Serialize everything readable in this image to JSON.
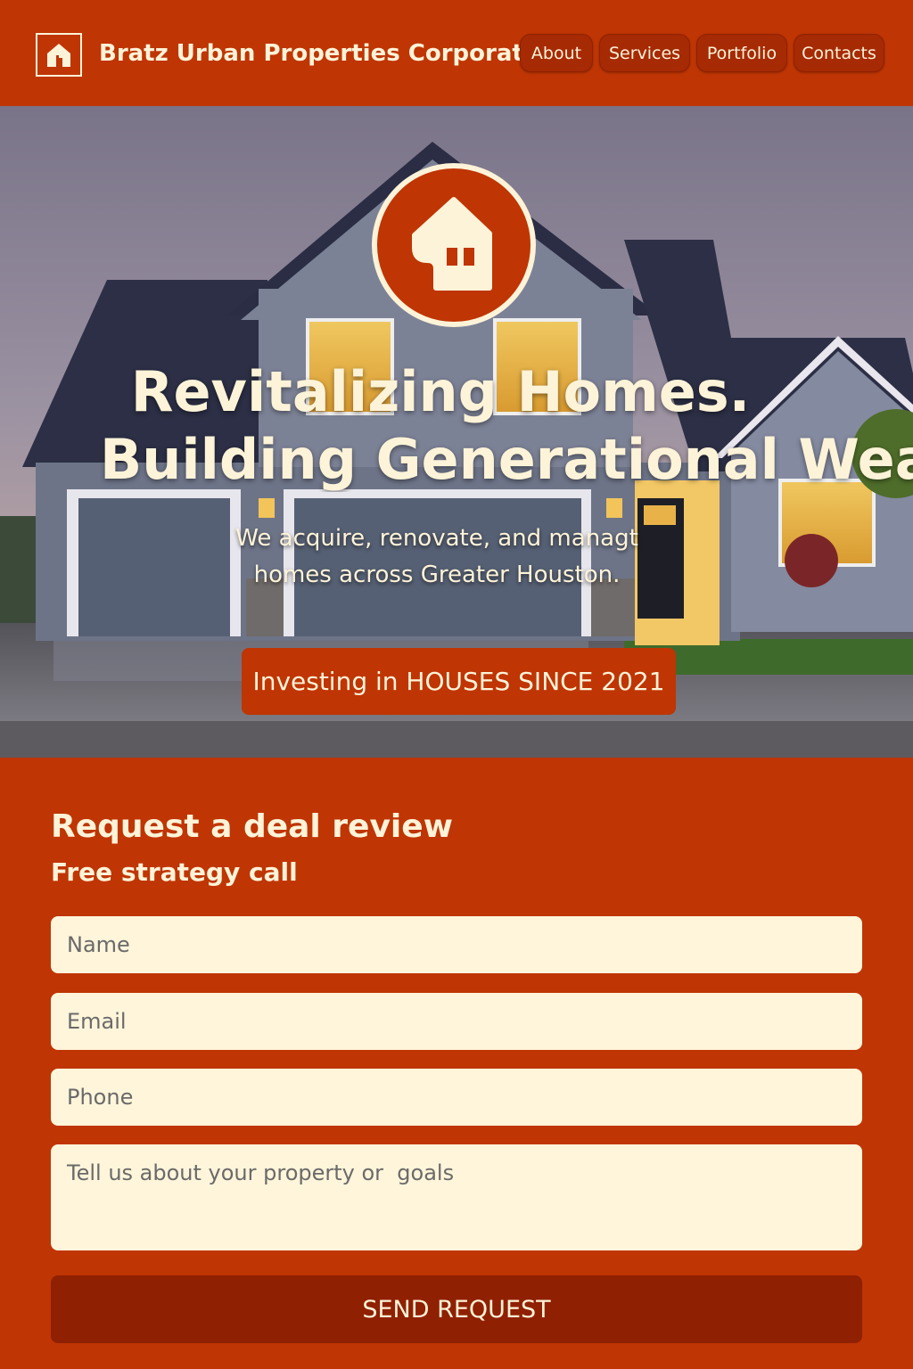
{
  "header": {
    "brand": "Bratz Urban Properties Corporation",
    "logo_icon": "house-icon",
    "nav": [
      {
        "label": "About"
      },
      {
        "label": "Services"
      },
      {
        "label": "Portfolio"
      },
      {
        "label": "Contacts"
      }
    ]
  },
  "hero": {
    "emblem_icon": "house-icon",
    "title_line1": "Revitalizing Homes.",
    "title_line2": "Building Generational Wealth",
    "subtitle": "We acquire, renovate, and managt homes across Greater Houston.",
    "badge": "Investing in HOUSES SINCE 2021"
  },
  "form": {
    "title": "Request a deal review",
    "subtitle": "Free strategy call",
    "name_placeholder": "Name",
    "email_placeholder": "Email",
    "phone_placeholder": "Phone",
    "message_placeholder": "Tell us about your property or  goals",
    "submit_label": "SEND REQUEST"
  },
  "colors": {
    "brand": "#bf3504",
    "button_dark": "#8f2001",
    "cream": "#fdf3d8"
  }
}
